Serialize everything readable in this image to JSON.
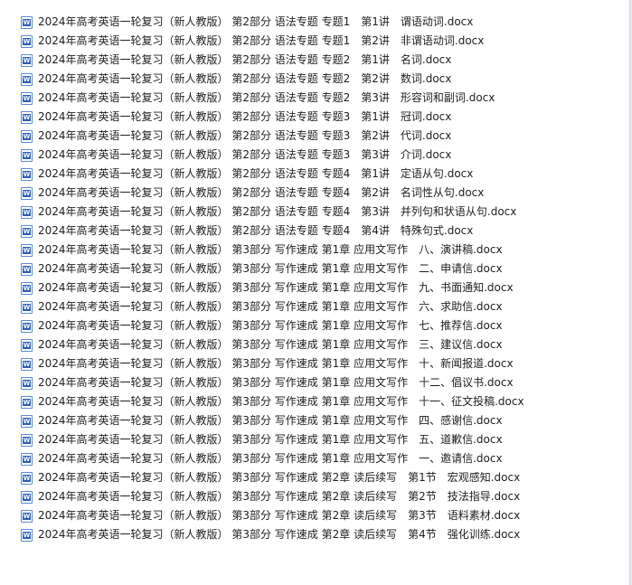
{
  "files": [
    "2024年高考英语一轮复习（新人教版） 第2部分 语法专题 专题1　第1讲　谓语动词.docx",
    "2024年高考英语一轮复习（新人教版） 第2部分 语法专题 专题1　第2讲　非谓语动词.docx",
    "2024年高考英语一轮复习（新人教版） 第2部分 语法专题 专题2　第1讲　名词.docx",
    "2024年高考英语一轮复习（新人教版） 第2部分 语法专题 专题2　第2讲　数词.docx",
    "2024年高考英语一轮复习（新人教版） 第2部分 语法专题 专题2　第3讲　形容词和副词.docx",
    "2024年高考英语一轮复习（新人教版） 第2部分 语法专题 专题3　第1讲　冠词.docx",
    "2024年高考英语一轮复习（新人教版） 第2部分 语法专题 专题3　第2讲　代词.docx",
    "2024年高考英语一轮复习（新人教版） 第2部分 语法专题 专题3　第3讲　介词.docx",
    "2024年高考英语一轮复习（新人教版） 第2部分 语法专题 专题4　第1讲　定语从句.docx",
    "2024年高考英语一轮复习（新人教版） 第2部分 语法专题 专题4　第2讲　名词性从句.docx",
    "2024年高考英语一轮复习（新人教版） 第2部分 语法专题 专题4　第3讲　并列句和状语从句.docx",
    "2024年高考英语一轮复习（新人教版） 第2部分 语法专题 专题4　第4讲　特殊句式.docx",
    "2024年高考英语一轮复习（新人教版） 第3部分 写作速成 第1章 应用文写作　八、演讲稿.docx",
    "2024年高考英语一轮复习（新人教版） 第3部分 写作速成 第1章 应用文写作　二、申请信.docx",
    "2024年高考英语一轮复习（新人教版） 第3部分 写作速成 第1章 应用文写作　九、书面通知.docx",
    "2024年高考英语一轮复习（新人教版） 第3部分 写作速成 第1章 应用文写作　六、求助信.docx",
    "2024年高考英语一轮复习（新人教版） 第3部分 写作速成 第1章 应用文写作　七、推荐信.docx",
    "2024年高考英语一轮复习（新人教版） 第3部分 写作速成 第1章 应用文写作　三、建议信.docx",
    "2024年高考英语一轮复习（新人教版） 第3部分 写作速成 第1章 应用文写作　十、新闻报道.docx",
    "2024年高考英语一轮复习（新人教版） 第3部分 写作速成 第1章 应用文写作　十二、倡议书.docx",
    "2024年高考英语一轮复习（新人教版） 第3部分 写作速成 第1章 应用文写作　十一、征文投稿.docx",
    "2024年高考英语一轮复习（新人教版） 第3部分 写作速成 第1章 应用文写作　四、感谢信.docx",
    "2024年高考英语一轮复习（新人教版） 第3部分 写作速成 第1章 应用文写作　五、道歉信.docx",
    "2024年高考英语一轮复习（新人教版） 第3部分 写作速成 第1章 应用文写作　一、邀请信.docx",
    "2024年高考英语一轮复习（新人教版） 第3部分 写作速成 第2章 读后续写　第1节　宏观感知.docx",
    "2024年高考英语一轮复习（新人教版） 第3部分 写作速成 第2章 读后续写　第2节　技法指导.docx",
    "2024年高考英语一轮复习（新人教版） 第3部分 写作速成 第2章 读后续写　第3节　语料素材.docx",
    "2024年高考英语一轮复习（新人教版） 第3部分 写作速成 第2章 读后续写　第4节　强化训练.docx"
  ],
  "icon": "word-doc-icon"
}
